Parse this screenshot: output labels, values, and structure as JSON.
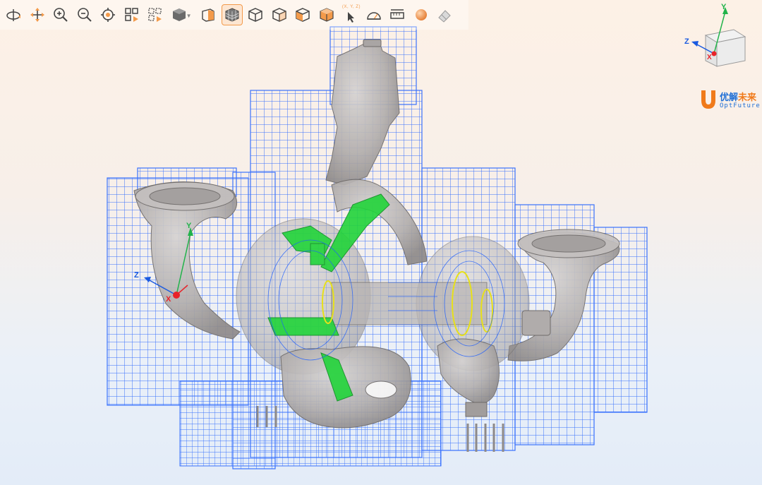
{
  "toolbar": {
    "tools": [
      {
        "name": "rotate-icon"
      },
      {
        "name": "pan-icon"
      },
      {
        "name": "zoom-in-icon"
      },
      {
        "name": "zoom-out-icon"
      },
      {
        "name": "target-center-icon"
      },
      {
        "name": "fit-all-icon"
      },
      {
        "name": "fit-selection-icon"
      },
      {
        "name": "view-cube-icon",
        "has_dropdown": true
      },
      {
        "name": "section-plane-icon"
      },
      {
        "name": "mesh-display-icon",
        "active": true
      },
      {
        "name": "view-iso-icon"
      },
      {
        "name": "view-front-icon"
      },
      {
        "name": "view-side-icon"
      },
      {
        "name": "view-solid-icon"
      },
      {
        "name": "pick-coordinate-icon",
        "caption": "(X, Y, Z)"
      },
      {
        "name": "angle-measure-icon"
      },
      {
        "name": "distance-measure-icon"
      },
      {
        "name": "material-sphere-icon"
      },
      {
        "name": "eraser-icon"
      }
    ]
  },
  "triad": {
    "x": "X",
    "y": "Y",
    "z": "Z"
  },
  "orientation_cube": {
    "x": "X",
    "y": "Y",
    "z": "Z"
  },
  "logo": {
    "main_a": "优解",
    "main_b": "未来",
    "sub": "OptFuture"
  },
  "colors": {
    "accent": "#f39a4a",
    "grid_blue": "#1a5cff",
    "part_gray": "#b9b6b5",
    "highlight_green": "#22d43a",
    "axis_x": "#e8232a",
    "axis_y": "#21b34a",
    "axis_z": "#1a5ae0"
  }
}
